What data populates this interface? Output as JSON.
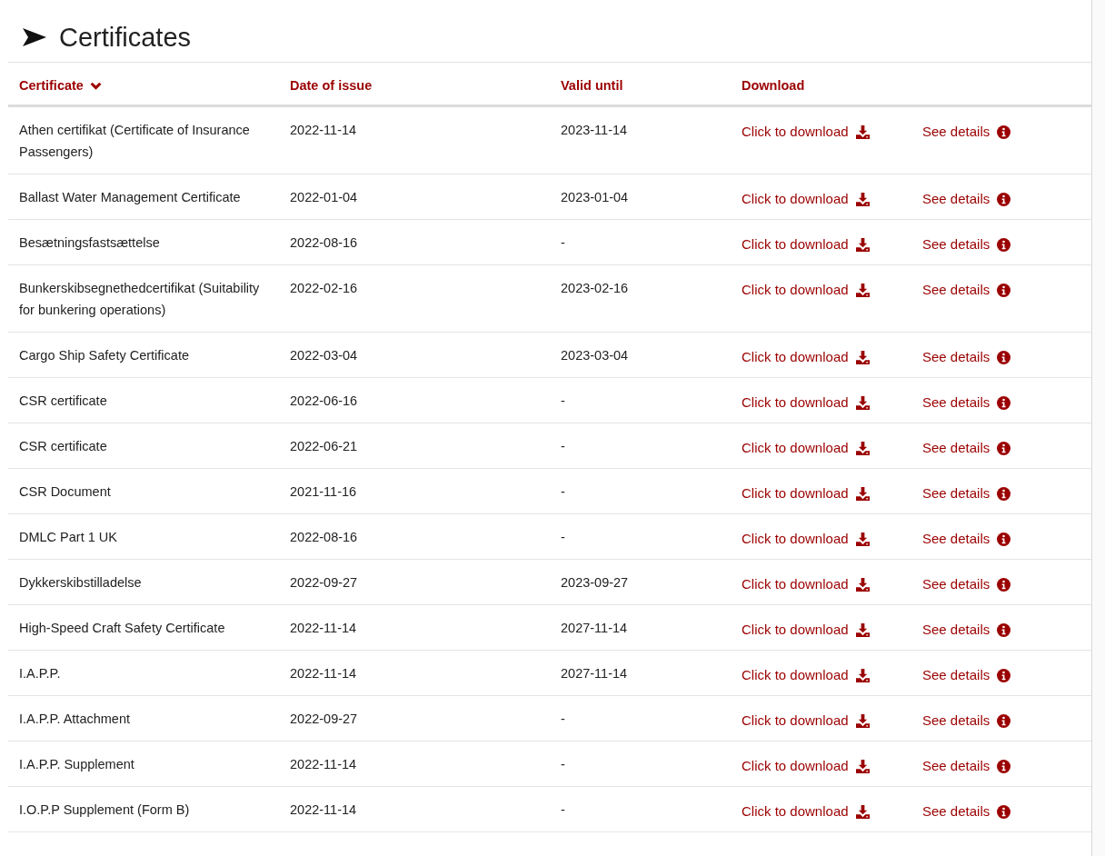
{
  "title": "Certificates",
  "columns": [
    {
      "label": "Certificate",
      "sorted": true
    },
    {
      "label": "Date of issue",
      "sorted": false
    },
    {
      "label": "Valid until",
      "sorted": false
    },
    {
      "label": "Download",
      "sorted": false
    }
  ],
  "rows": [
    {
      "certificate": "Athen certifikat (Certificate of Insurance Passengers)",
      "issued": "2022-11-14",
      "valid": "2023-11-14",
      "download": "Click to download",
      "details": "See details"
    },
    {
      "certificate": "Ballast Water Management Certificate",
      "issued": "2022-01-04",
      "valid": "2023-01-04",
      "download": "Click to download",
      "details": "See details"
    },
    {
      "certificate": "Besætningsfastsættelse",
      "issued": "2022-08-16",
      "valid": "-",
      "download": "Click to download",
      "details": "See details"
    },
    {
      "certificate": "Bunkerskibsegnethedcertifikat (Suitability for bunkering operations)",
      "issued": "2022-02-16",
      "valid": "2023-02-16",
      "download": "Click to download",
      "details": "See details"
    },
    {
      "certificate": "Cargo Ship Safety Certificate",
      "issued": "2022-03-04",
      "valid": "2023-03-04",
      "download": "Click to download",
      "details": "See details"
    },
    {
      "certificate": "CSR certificate",
      "issued": "2022-06-16",
      "valid": "-",
      "download": "Click to download",
      "details": "See details"
    },
    {
      "certificate": "CSR certificate",
      "issued": "2022-06-21",
      "valid": "-",
      "download": "Click to download",
      "details": "See details"
    },
    {
      "certificate": "CSR Document",
      "issued": "2021-11-16",
      "valid": "-",
      "download": "Click to download",
      "details": "See details"
    },
    {
      "certificate": "DMLC Part 1 UK",
      "issued": "2022-08-16",
      "valid": "-",
      "download": "Click to download",
      "details": "See details"
    },
    {
      "certificate": "Dykkerskibstilladelse",
      "issued": "2022-09-27",
      "valid": "2023-09-27",
      "download": "Click to download",
      "details": "See details"
    },
    {
      "certificate": "High-Speed Craft Safety Certificate",
      "issued": "2022-11-14",
      "valid": "2027-11-14",
      "download": "Click to download",
      "details": "See details"
    },
    {
      "certificate": "I.A.P.P.",
      "issued": "2022-11-14",
      "valid": "2027-11-14",
      "download": "Click to download",
      "details": "See details"
    },
    {
      "certificate": "I.A.P.P. Attachment",
      "issued": "2022-09-27",
      "valid": "-",
      "download": "Click to download",
      "details": "See details"
    },
    {
      "certificate": "I.A.P.P. Supplement",
      "issued": "2022-11-14",
      "valid": "-",
      "download": "Click to download",
      "details": "See details"
    },
    {
      "certificate": "I.O.P.P Supplement (Form B)",
      "issued": "2022-11-14",
      "valid": "-",
      "download": "Click to download",
      "details": "See details"
    }
  ]
}
